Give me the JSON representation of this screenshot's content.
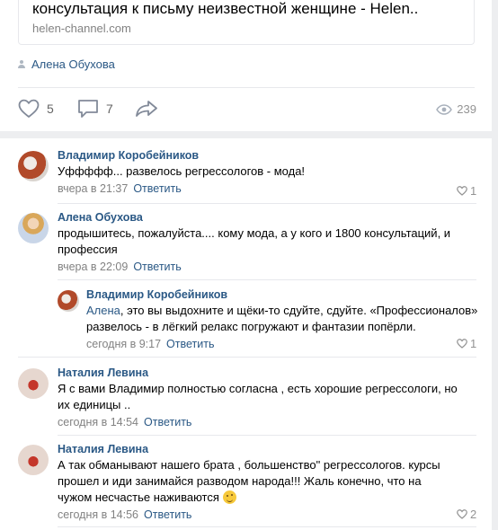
{
  "link": {
    "title": "консультация к письму неизвестной женщине - Helen..",
    "domain": "helen-channel.com"
  },
  "author": "Алена Обухова",
  "actions": {
    "likes": "5",
    "comments": "7",
    "views": "239"
  },
  "comments": [
    {
      "author": "Владимир Коробейников",
      "text": "Уффффф... развелось регрессологов - мода!",
      "time": "вчера в 21:37",
      "reply": "Ответить",
      "likes": "1"
    },
    {
      "author": "Алена Обухова",
      "text": "продышитесь, пожалуйста.... кому мода, а у кого и 1800 консультаций, и профессия",
      "time": "вчера в 22:09",
      "reply": "Ответить",
      "likes": ""
    },
    {
      "author": "Владимир Коробейников",
      "mention": "Алена",
      "text": ", это вы выдохните и щёки-то сдуйте, сдуйте. «Профессионалов» развелось - в лёгкий релакс погружают и фантазии попёрли.",
      "time": "сегодня в 9:17",
      "reply": "Ответить",
      "likes": "1"
    },
    {
      "author": "Наталия Левина",
      "text": "Я с вами Владимир полностью согласна , есть хорошие регрессологи, но их единицы ..",
      "time": "сегодня в 14:54",
      "reply": "Ответить",
      "likes": ""
    },
    {
      "author": "Наталия Левина",
      "text": "А так обманывают нашего брата , большенство\" регрессологов. курсы прошел и иди занимайся разводом народа!!! Жаль конечно, что на чужом несчастье наживаются",
      "time": "сегодня в 14:56",
      "reply": "Ответить",
      "likes": "2"
    }
  ],
  "colors": {
    "link": "#2a5885",
    "muted": "#828282",
    "icon": "#828a99",
    "border": "#e7e8ec"
  }
}
